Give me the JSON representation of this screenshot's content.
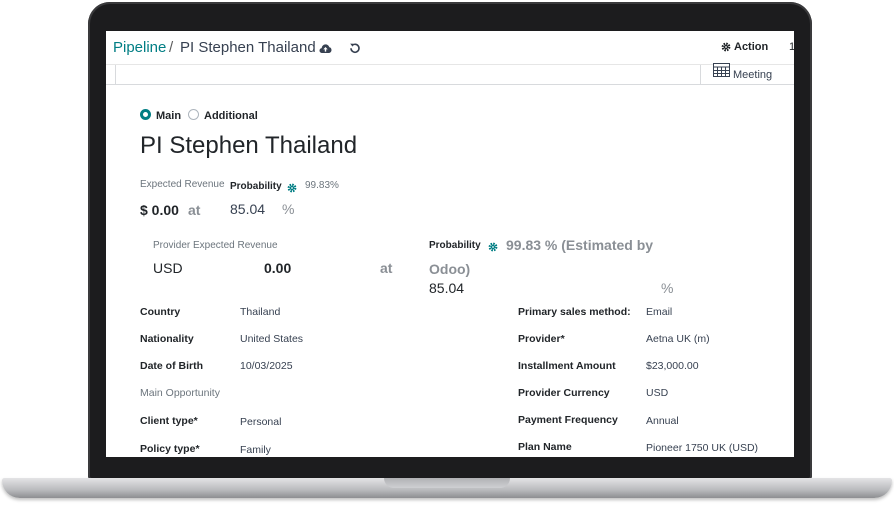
{
  "breadcrumb": {
    "parent": "Pipeline",
    "separator": "/",
    "current": "PI Stephen Thailand"
  },
  "toolbar": {
    "save_icon": "cloud-upload-icon",
    "discard_icon": "undo-icon",
    "action_label": "Action",
    "action_icon": "gear-icon",
    "pager_text": "1"
  },
  "smart_buttons": {
    "meeting_label": "Meeting",
    "meeting_icon": "calendar-icon"
  },
  "view_switch": {
    "main_label": "Main",
    "additional_label": "Additional",
    "selected": "Main"
  },
  "record": {
    "title": "PI Stephen Thailand"
  },
  "revenue_block": {
    "expected_revenue_label": "Expected Revenue",
    "probability_label": "Probability",
    "probability_estimate": "99.83%",
    "expected_revenue_value": "$ 0.00",
    "at_text": "at",
    "probability_value": "85.04",
    "percent_sign": "%"
  },
  "provider_block": {
    "label": "Provider Expected Revenue",
    "currency": "USD",
    "amount": "0.00",
    "at_text": "at",
    "probability_label": "Probability",
    "probability_estimate": "99.83 % (Estimated by",
    "estimate_suffix": "Odoo)",
    "probability_value": "85.04",
    "percent_sign": "%"
  },
  "left_fields": [
    {
      "label": "Country",
      "value": "Thailand"
    },
    {
      "label": "Nationality",
      "value": "United States"
    },
    {
      "label": "Date of Birth",
      "value": "10/03/2025"
    },
    {
      "label": "Main Opportunity",
      "value": ""
    },
    {
      "label": "Client type*",
      "value": "Personal"
    },
    {
      "label": "Policy type*",
      "value": "Family"
    }
  ],
  "right_fields": [
    {
      "label": "Primary sales method:",
      "value": "Email"
    },
    {
      "label": "Provider*",
      "value": "Aetna UK (m)"
    },
    {
      "label": "Installment Amount",
      "value": "$23,000.00"
    },
    {
      "label": "Provider Currency",
      "value": "USD"
    },
    {
      "label": "Payment Frequency",
      "value": "Annual"
    },
    {
      "label": "Plan Name",
      "value": "Pioneer 1750 UK (USD)"
    }
  ],
  "colors": {
    "accent": "#017e84",
    "frame": "#1c1c1e"
  }
}
